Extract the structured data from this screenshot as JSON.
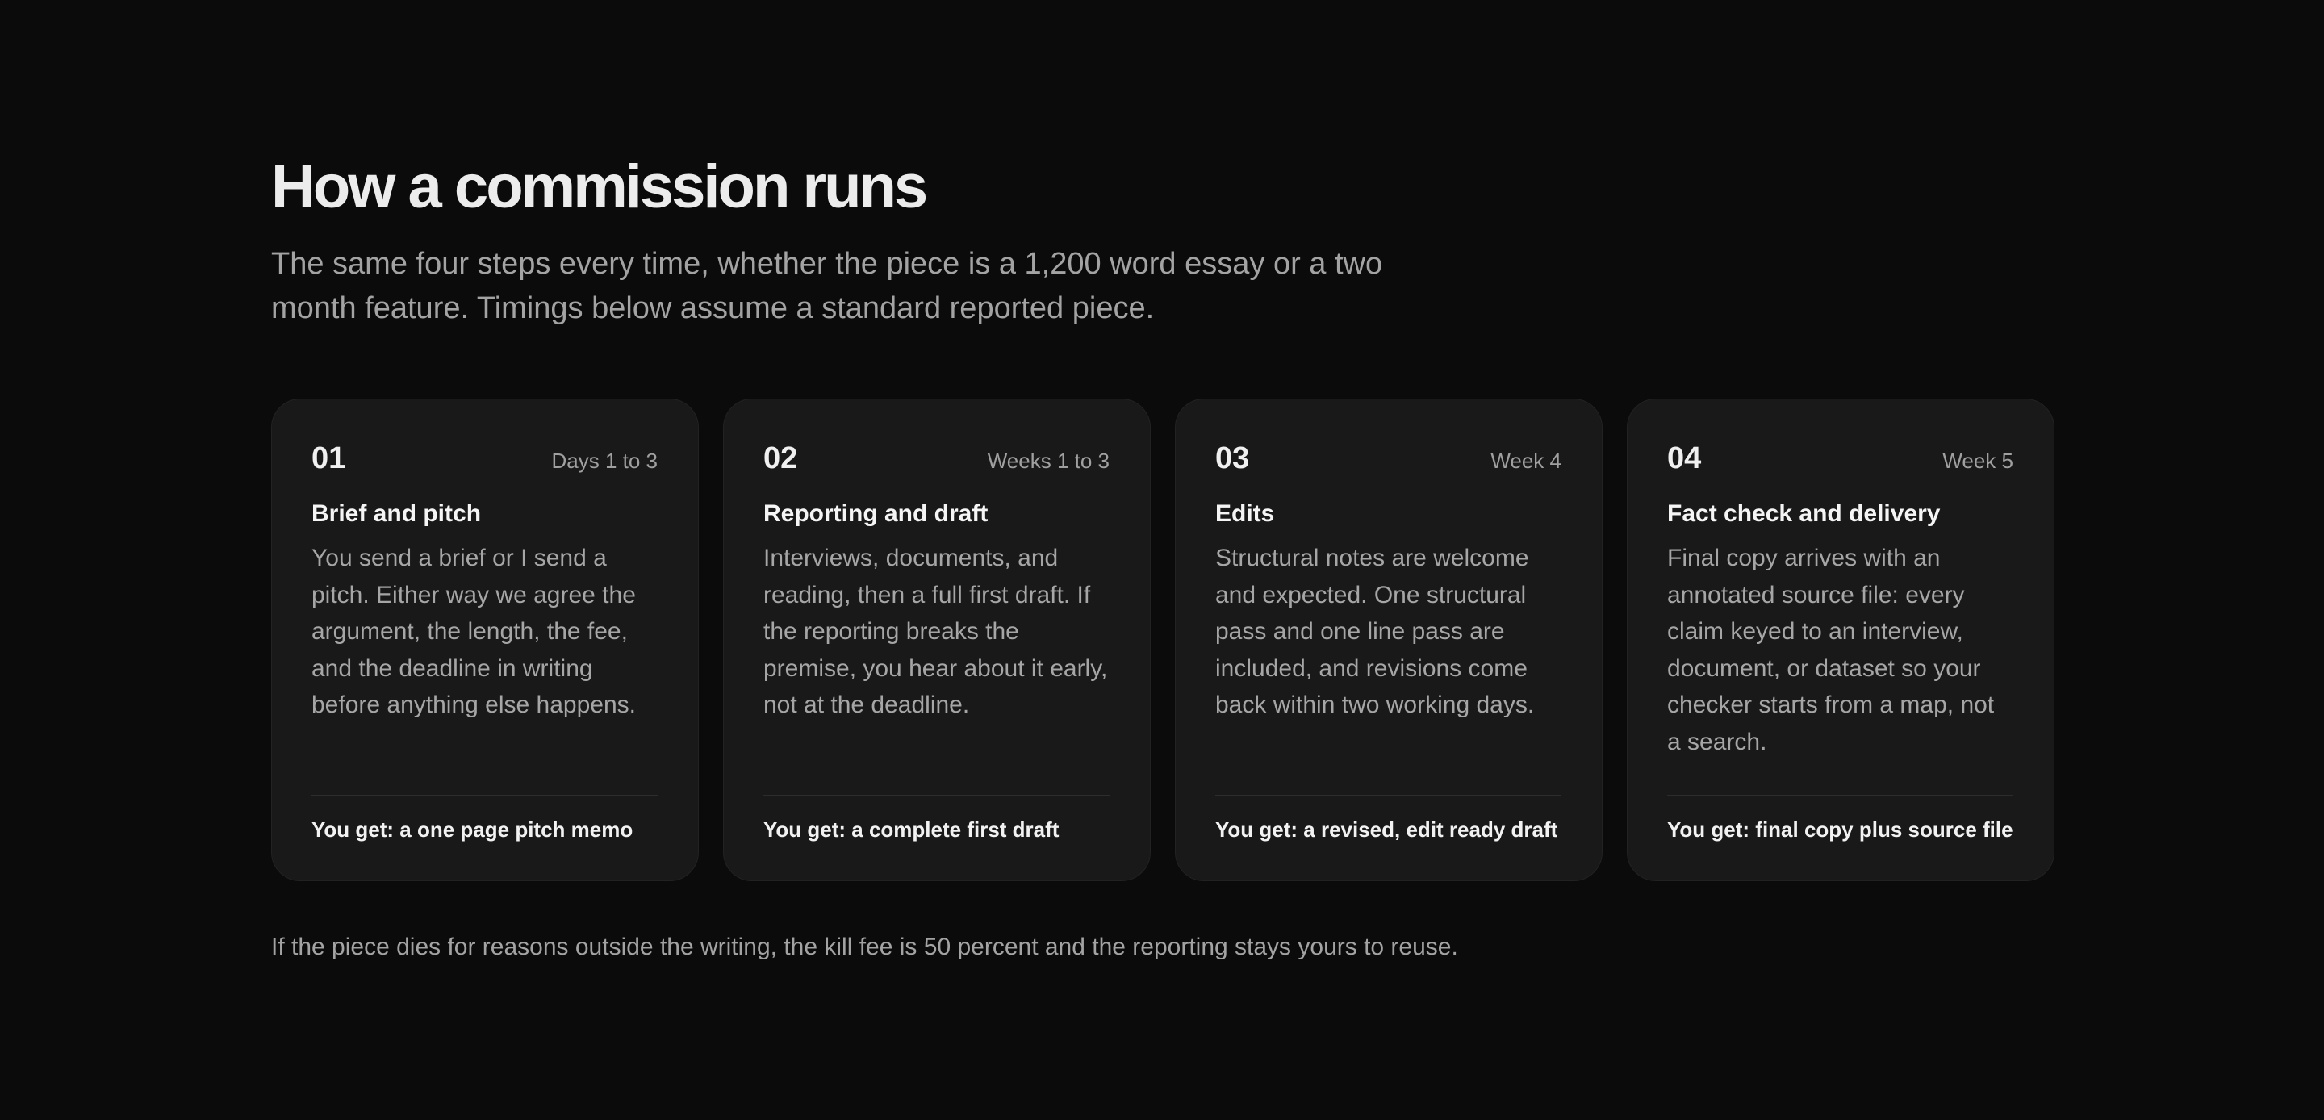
{
  "section": {
    "title": "How a commission runs",
    "subtitle": "The same four steps every time, whether the piece is a 1,200 word essay or a two month feature. Timings below assume a standard reported piece.",
    "footnote": "If the piece dies for reasons outside the writing, the kill fee is 50 percent and the reporting stays yours to reuse."
  },
  "steps": [
    {
      "number": "01",
      "timing": "Days 1 to 3",
      "title": "Brief and pitch",
      "body": "You send a brief or I send a pitch. Either way we agree the argument, the length, the fee, and the deadline in writing before anything else happens.",
      "deliverable": "You get: a one page pitch memo"
    },
    {
      "number": "02",
      "timing": "Weeks 1 to 3",
      "title": "Reporting and draft",
      "body": "Interviews, documents, and reading, then a full first draft. If the reporting breaks the premise, you hear about it early, not at the deadline.",
      "deliverable": "You get: a complete first draft"
    },
    {
      "number": "03",
      "timing": "Week 4",
      "title": "Edits",
      "body": "Structural notes are welcome and expected. One structural pass and one line pass are included, and revisions come back within two working days.",
      "deliverable": "You get: a revised, edit ready draft"
    },
    {
      "number": "04",
      "timing": "Week 5",
      "title": "Fact check and delivery",
      "body": "Final copy arrives with an annotated source file: every claim keyed to an interview, document, or dataset so your checker starts from a map, not a search.",
      "deliverable": "You get: final copy plus source file"
    }
  ]
}
